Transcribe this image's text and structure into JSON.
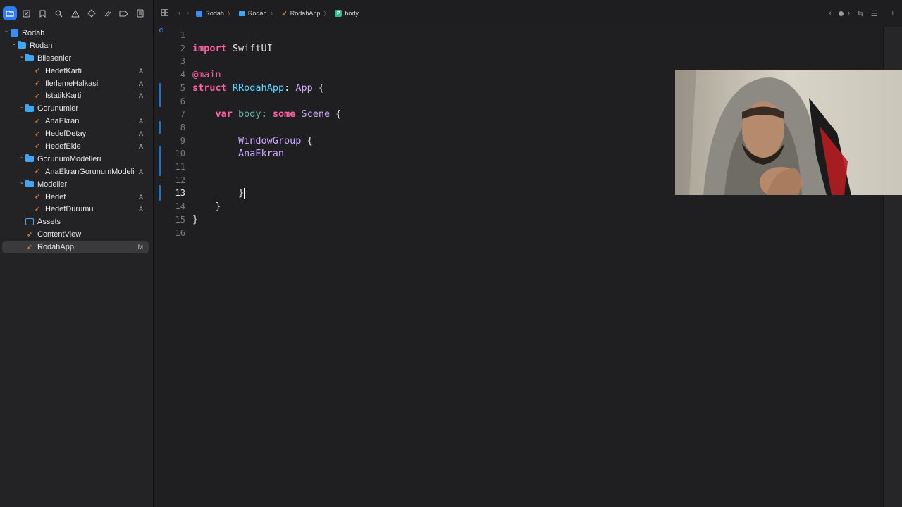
{
  "nav_toolbar": {
    "icons": [
      "folder-icon",
      "source-control-icon",
      "bookmark-icon",
      "search-icon",
      "warning-icon",
      "test-icon",
      "debug-icon",
      "breakpoint-icon",
      "report-icon"
    ]
  },
  "tree": [
    {
      "name": "Rodah",
      "kind": "project",
      "depth": 0,
      "chevron": "down",
      "badge": ""
    },
    {
      "name": "Rodah",
      "kind": "folder",
      "depth": 1,
      "chevron": "down",
      "badge": ""
    },
    {
      "name": "Bilesenler",
      "kind": "folder",
      "depth": 2,
      "chevron": "down",
      "badge": ""
    },
    {
      "name": "HedefKarti",
      "kind": "swift",
      "depth": 3,
      "badge": "A"
    },
    {
      "name": "IlerlemeHalkasi",
      "kind": "swift",
      "depth": 3,
      "badge": "A"
    },
    {
      "name": "IstatikKarti",
      "kind": "swift",
      "depth": 3,
      "badge": "A"
    },
    {
      "name": "Gorunumler",
      "kind": "folder",
      "depth": 2,
      "chevron": "down",
      "badge": ""
    },
    {
      "name": "AnaEkran",
      "kind": "swift",
      "depth": 3,
      "badge": "A"
    },
    {
      "name": "HedefDetay",
      "kind": "swift",
      "depth": 3,
      "badge": "A"
    },
    {
      "name": "HedefEkle",
      "kind": "swift",
      "depth": 3,
      "badge": "A"
    },
    {
      "name": "GorunumModelleri",
      "kind": "folder",
      "depth": 2,
      "chevron": "down",
      "badge": ""
    },
    {
      "name": "AnaEkranGorunumModeli",
      "kind": "swift",
      "depth": 3,
      "badge": "A"
    },
    {
      "name": "Modeller",
      "kind": "folder",
      "depth": 2,
      "chevron": "down",
      "badge": ""
    },
    {
      "name": "Hedef",
      "kind": "swift",
      "depth": 3,
      "badge": "A"
    },
    {
      "name": "HedefDurumu",
      "kind": "swift",
      "depth": 3,
      "badge": "A"
    },
    {
      "name": "Assets",
      "kind": "assets",
      "depth": 2,
      "badge": ""
    },
    {
      "name": "ContentView",
      "kind": "swift",
      "depth": 2,
      "badge": ""
    },
    {
      "name": "RodahApp",
      "kind": "swift",
      "depth": 2,
      "badge": "M",
      "selected": true
    }
  ],
  "breadcrumb": [
    "Rodah",
    "Rodah",
    "RodahApp",
    "body"
  ],
  "editor": {
    "current_line": 13,
    "lines": [
      {
        "n": "1",
        "tokens": []
      },
      {
        "n": "2",
        "tokens": [
          [
            "kw",
            "import"
          ],
          [
            "",
            " "
          ],
          [
            "",
            "SwiftUI"
          ]
        ]
      },
      {
        "n": "3",
        "tokens": []
      },
      {
        "n": "4",
        "tokens": [
          [
            "at",
            "@main"
          ]
        ]
      },
      {
        "n": "5",
        "tokens": [
          [
            "kw",
            "struct"
          ],
          [
            "",
            " "
          ],
          [
            "tyc",
            "RRodahApp"
          ],
          [
            "",
            ": "
          ],
          [
            "ty",
            "App"
          ],
          [
            "",
            " {"
          ]
        ]
      },
      {
        "n": "6",
        "tokens": []
      },
      {
        "n": "7",
        "tokens": [
          [
            "",
            "    "
          ],
          [
            "kw",
            "var"
          ],
          [
            "",
            " "
          ],
          [
            "var",
            "body"
          ],
          [
            "",
            ": "
          ],
          [
            "kw",
            "some"
          ],
          [
            "",
            " "
          ],
          [
            "ty",
            "Scene"
          ],
          [
            "",
            " {"
          ]
        ]
      },
      {
        "n": "8",
        "tokens": []
      },
      {
        "n": "9",
        "tokens": [
          [
            "",
            "        "
          ],
          [
            "ty",
            "WindowGroup"
          ],
          [
            "",
            " {"
          ]
        ]
      },
      {
        "n": "10",
        "tokens": [
          [
            "",
            "        "
          ],
          [
            "ty",
            "AnaEkran"
          ]
        ]
      },
      {
        "n": "11",
        "tokens": []
      },
      {
        "n": "12",
        "tokens": []
      },
      {
        "n": "13",
        "tokens": [
          [
            "",
            "        }"
          ]
        ],
        "caret": true
      },
      {
        "n": "14",
        "tokens": [
          [
            "",
            "    }"
          ]
        ]
      },
      {
        "n": "15",
        "tokens": [
          [
            "",
            "}"
          ]
        ]
      },
      {
        "n": "16",
        "tokens": []
      }
    ]
  }
}
